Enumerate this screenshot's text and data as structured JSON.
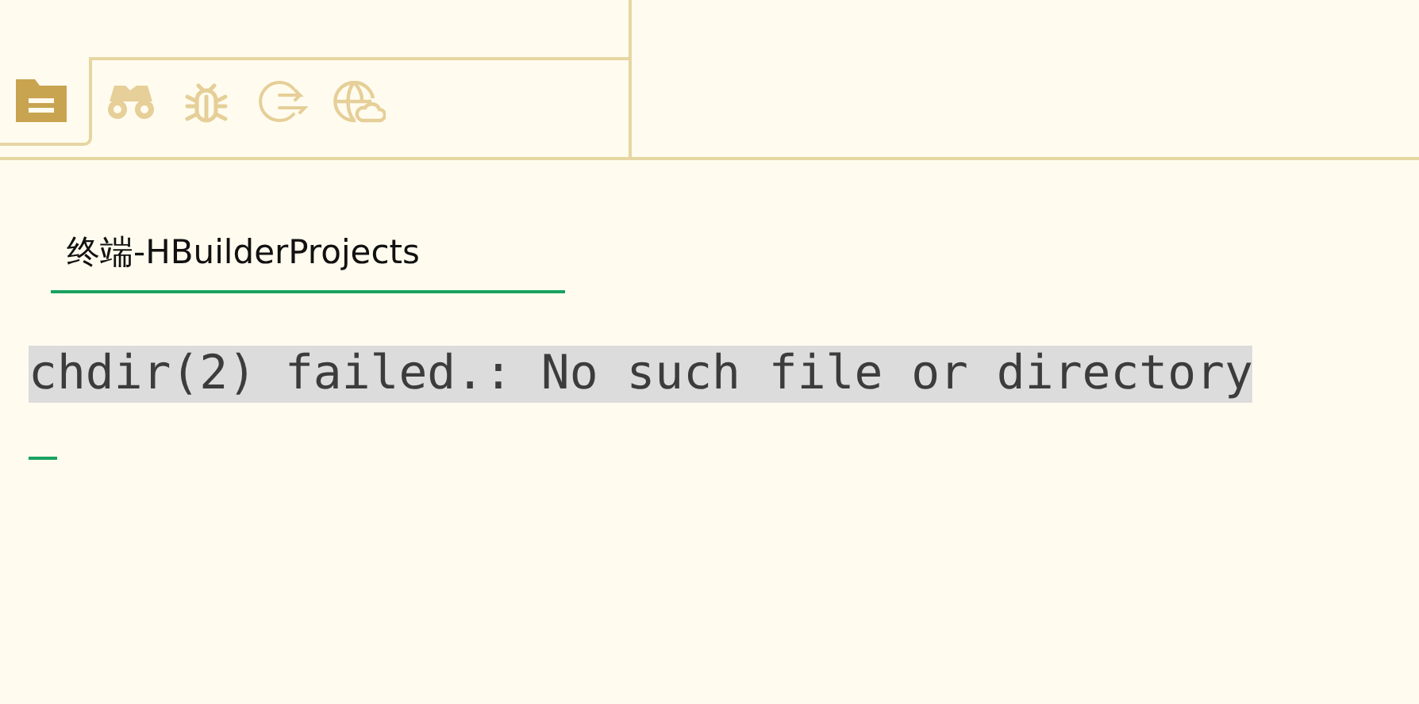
{
  "panel_tabs": [
    {
      "kind": "folder",
      "selected": true
    },
    {
      "kind": "binoculars",
      "selected": false
    },
    {
      "kind": "bug",
      "selected": false
    },
    {
      "kind": "export",
      "selected": false
    },
    {
      "kind": "globe-cloud",
      "selected": false
    }
  ],
  "terminal_tabs": [
    {
      "label": "终端-HBuilderProjects",
      "selected": true
    }
  ],
  "output_lines": [
    {
      "text": "chdir(2) failed.: No such file or directory",
      "highlighted": true
    }
  ],
  "cursor": {
    "visible": true
  }
}
